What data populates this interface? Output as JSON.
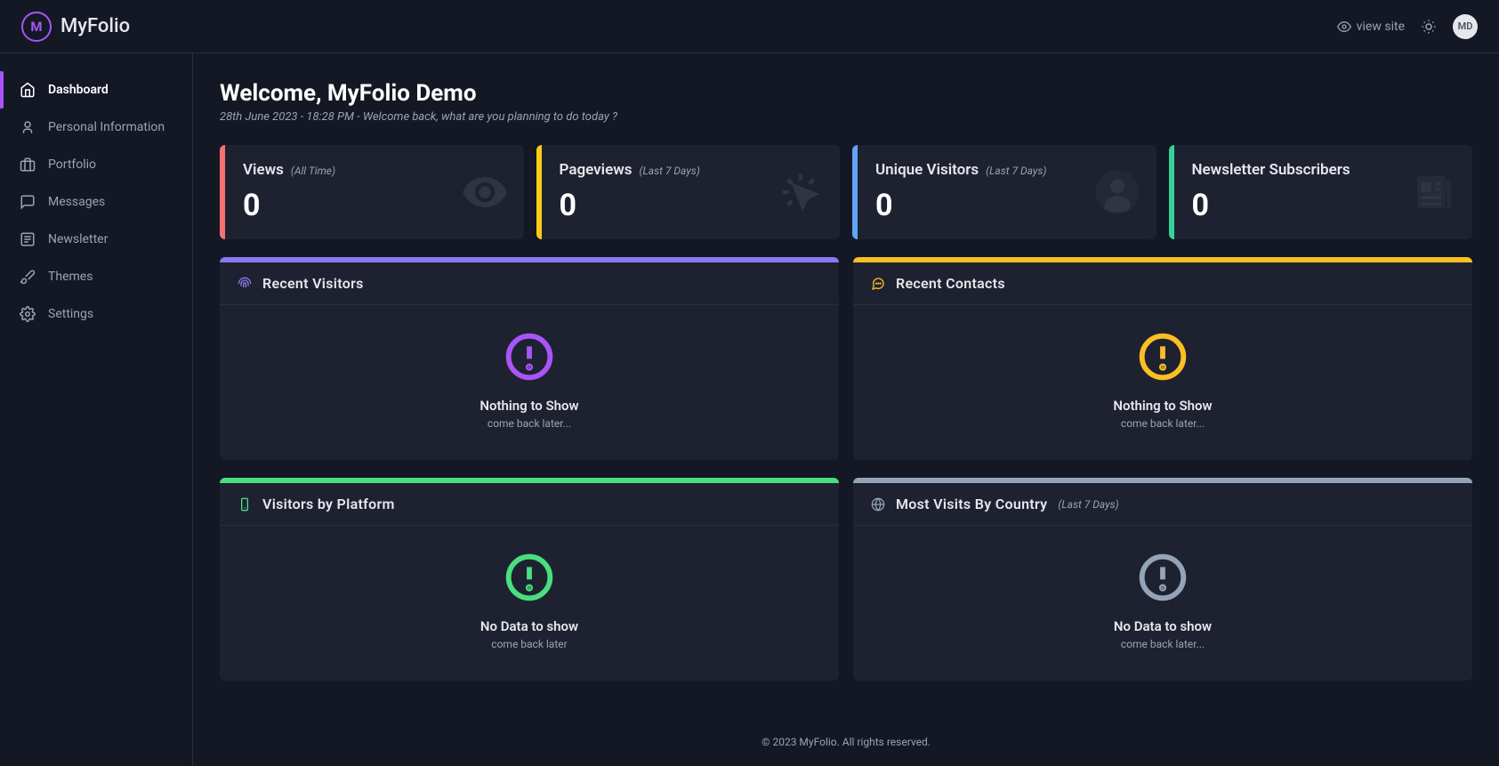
{
  "brand": {
    "name": "MyFolio",
    "logo_letter": "M"
  },
  "header": {
    "view_site": "view site",
    "avatar": "MD"
  },
  "sidebar": {
    "items": [
      {
        "label": "Dashboard",
        "icon": "home",
        "active": true
      },
      {
        "label": "Personal Information",
        "icon": "user",
        "active": false
      },
      {
        "label": "Portfolio",
        "icon": "briefcase",
        "active": false
      },
      {
        "label": "Messages",
        "icon": "message",
        "active": false
      },
      {
        "label": "Newsletter",
        "icon": "newspaper",
        "active": false
      },
      {
        "label": "Themes",
        "icon": "brush",
        "active": false
      },
      {
        "label": "Settings",
        "icon": "gear",
        "active": false
      }
    ]
  },
  "welcome": {
    "title": "Welcome, MyFolio Demo",
    "subtitle": "28th June 2023 - 18:28 PM - Welcome back, what are you planning to do today ?"
  },
  "stats": [
    {
      "title": "Views",
      "timeframe": "(All Time)",
      "value": "0",
      "accent": "#f87171",
      "icon": "eye"
    },
    {
      "title": "Pageviews",
      "timeframe": "(Last 7 Days)",
      "value": "0",
      "accent": "#facc15",
      "icon": "click"
    },
    {
      "title": "Unique Visitors",
      "timeframe": "(Last 7 Days)",
      "value": "0",
      "accent": "#60a5fa",
      "icon": "person"
    },
    {
      "title": "Newsletter Subscribers",
      "timeframe": "",
      "value": "0",
      "accent": "#34d399",
      "icon": "news"
    }
  ],
  "panels": {
    "recent_visitors": {
      "title": "Recent Visitors",
      "accent": "#8b79f0",
      "icon_color": "#8b79f0",
      "empty_title": "Nothing to Show",
      "empty_sub": "come back later...",
      "empty_color": "#a855f7"
    },
    "recent_contacts": {
      "title": "Recent Contacts",
      "accent": "#fbbf24",
      "icon_color": "#fbbf24",
      "empty_title": "Nothing to Show",
      "empty_sub": "come back later...",
      "empty_color": "#fbbf24"
    },
    "visitors_platform": {
      "title": "Visitors by Platform",
      "accent": "#4ade80",
      "icon_color": "#4ade80",
      "empty_title": "No Data to show",
      "empty_sub": "come back later",
      "empty_color": "#4ade80"
    },
    "visits_country": {
      "title": "Most Visits By Country",
      "subtitle": "(Last 7 Days)",
      "accent": "#94a3b8",
      "icon_color": "#94a3b8",
      "empty_title": "No Data to show",
      "empty_sub": "come back later...",
      "empty_color": "#94a3b8"
    }
  },
  "footer": "© 2023 MyFolio. All rights reserved."
}
